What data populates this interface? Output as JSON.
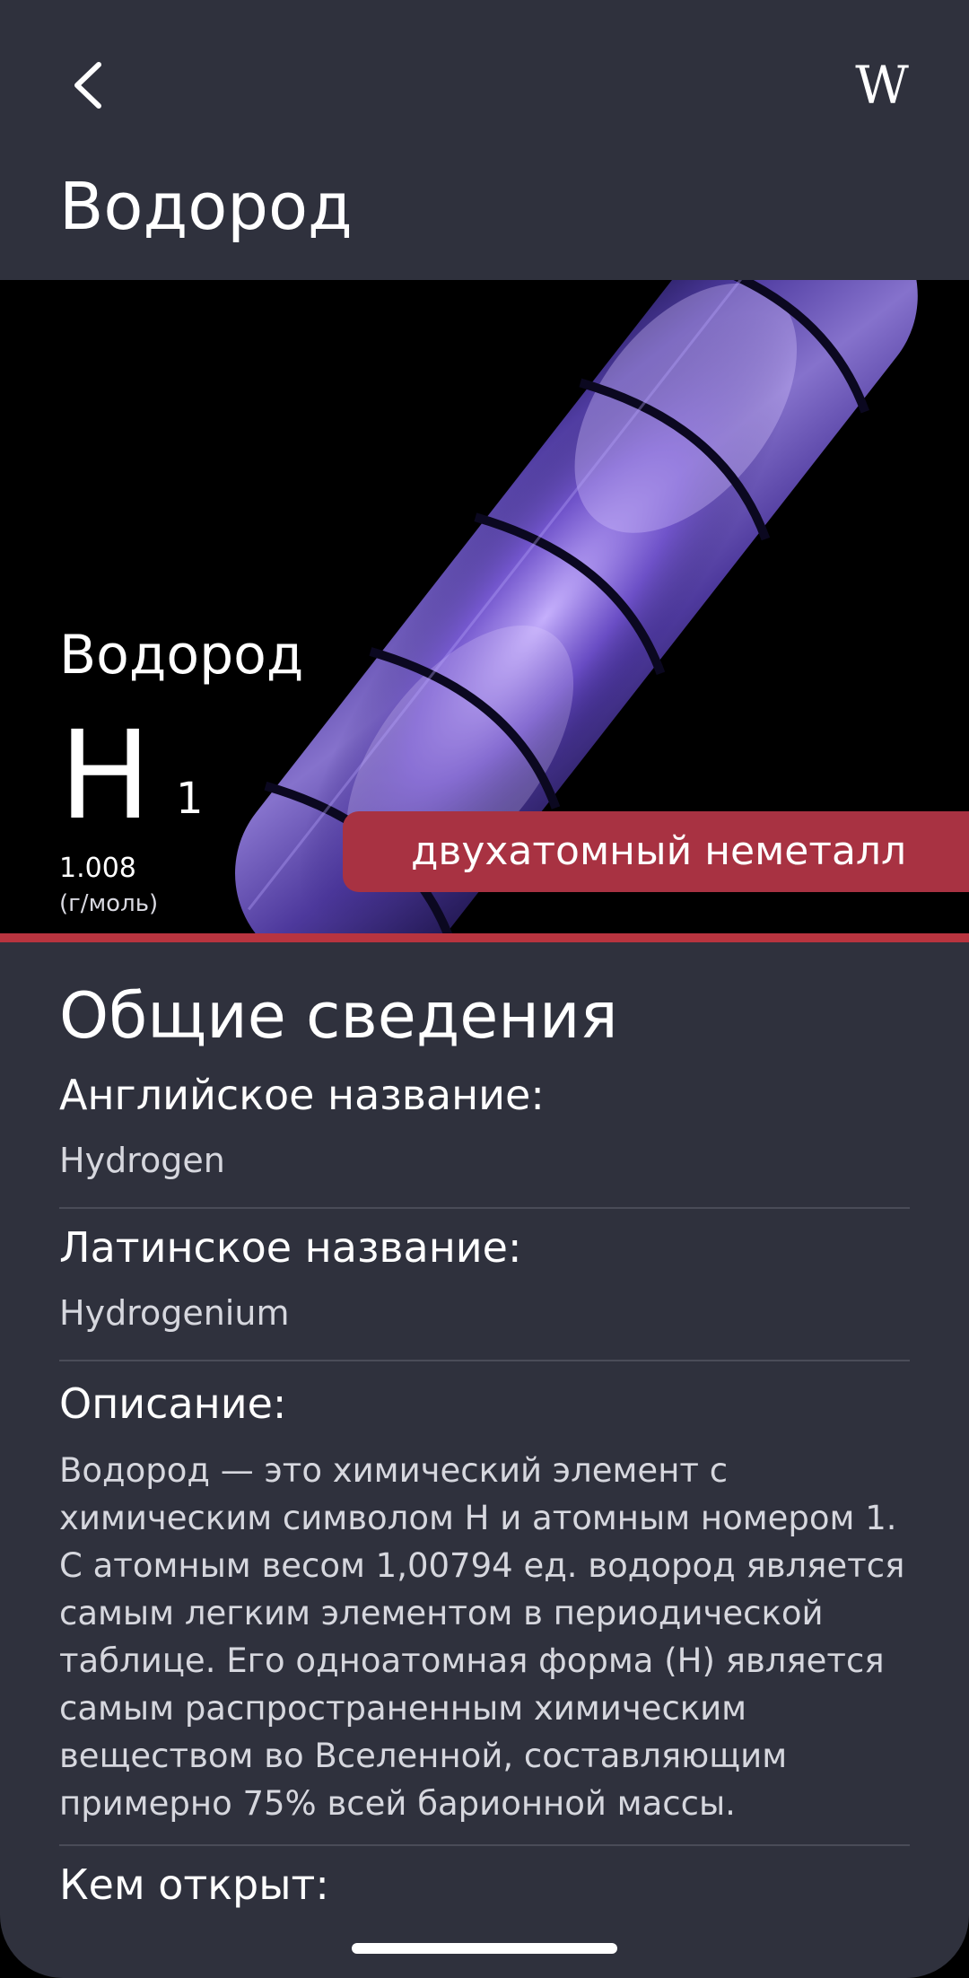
{
  "header": {
    "back_icon": "chevron-left-icon",
    "wiki_label": "W",
    "title": "Водород"
  },
  "hero": {
    "image": "hydrogen discharge tube glowing purple",
    "name": "Водород",
    "symbol": "H",
    "atomic_number": "1",
    "atomic_mass": "1.008",
    "mass_unit": "(г/моль)",
    "category": "двухатомный неметалл",
    "category_color": "#a83242",
    "accent_line_color": "#b8343f"
  },
  "general": {
    "title": "Общие сведения",
    "english_label": "Английское название:",
    "english_value": "Hydrogen",
    "latin_label": "Латинское название:",
    "latin_value": "Hydrogenium",
    "description_label": "Описание:",
    "description": "Водород — это химический элемент с химическим символом H и атомным номером 1. С атомным весом 1,00794 ед. водород является самым легким элементом в периодической таблице. Его одноатомная форма (H) является самым распространенным химическим веществом во Вселенной, составляющим примерно 75% всей барионной массы.",
    "discovered_label": "Кем открыт:"
  },
  "colors": {
    "background": "#2f313d",
    "divider": "#4a4c58"
  }
}
